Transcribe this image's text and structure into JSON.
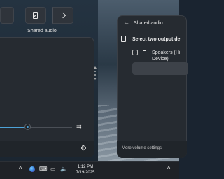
{
  "quick_settings": {
    "tile_label": "Shared audio",
    "volume_percent": 38,
    "output_icon": "speaker-switch-icon"
  },
  "shared_audio": {
    "title": "Shared audio",
    "heading": "Select two output de",
    "device_name": "Speakers (Hi\nDevice)",
    "footer_link": "More volume settings"
  },
  "taskbar": {
    "up_arrow": "^",
    "time": "1:12 PM",
    "date": "7/19/2025",
    "tray_icons": [
      "copilot-icon",
      "keyboard-icon",
      "network-icon",
      "volume-icon"
    ]
  },
  "colors": {
    "accent": "#4da3d8",
    "panel": "#262b31"
  }
}
